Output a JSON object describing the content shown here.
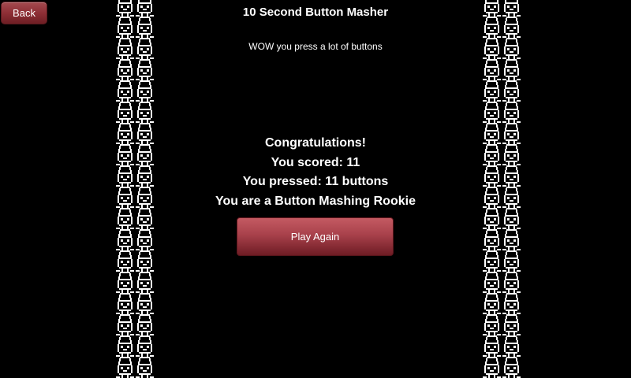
{
  "header": {
    "back_label": "Back",
    "title": "10 Second Button Masher",
    "subtitle": "WOW you press a lot of buttons"
  },
  "results": {
    "congrats": "Congratulations!",
    "score": "You scored: 11",
    "pressed": "You pressed: 11 buttons",
    "rank": "You are a Button Mashing Rookie"
  },
  "actions": {
    "play_again_label": "Play Again"
  },
  "decor": {
    "sprite_icon": "pixel-creature-icon",
    "accent_color": "#8e2f36",
    "background_color": "#000000"
  }
}
